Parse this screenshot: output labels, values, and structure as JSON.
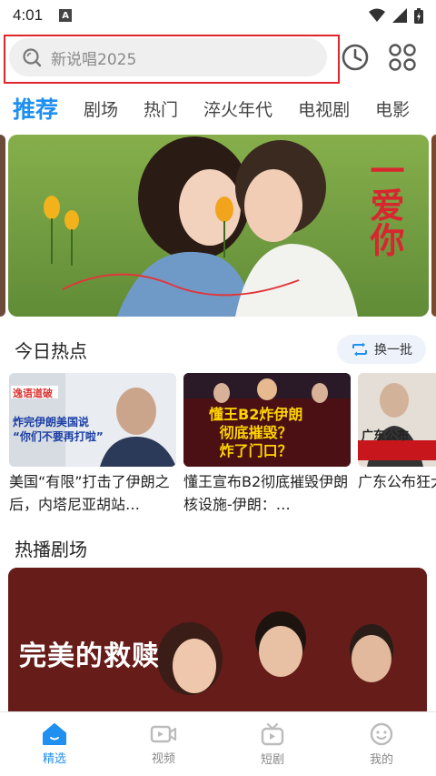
{
  "status_bar": {
    "time": "4:01",
    "notification_badge": "A"
  },
  "search": {
    "placeholder": "新说唱2025"
  },
  "tabs": [
    {
      "label": "推荐",
      "active": true
    },
    {
      "label": "剧场"
    },
    {
      "label": "热门"
    },
    {
      "label": "淬火年代"
    },
    {
      "label": "电视剧"
    },
    {
      "label": "电影"
    }
  ],
  "banner": {
    "title": "一爱你"
  },
  "hot_today": {
    "title": "今日热点",
    "refresh_label": "换一批",
    "items": [
      {
        "thumb_text": "炸完伊朗美国说\n“你们不要再打啦”",
        "caption": "美国“有限”打击了伊朗之后，内塔尼亚胡站…"
      },
      {
        "thumb_text": "懂王B2炸伊朗\n彻底摧毁？\n炸了门口？",
        "caption": "懂王宣布B2彻底摧毁伊朗核设施-伊朗：…"
      },
      {
        "thumb_text": "广东公布",
        "caption": "广东公布狂犬病可"
      }
    ]
  },
  "hot_theater": {
    "title": "热播剧场",
    "card_title": "完美的救赎"
  },
  "bottom_nav": [
    {
      "label": "精选",
      "icon": "home-icon",
      "active": true
    },
    {
      "label": "视频",
      "icon": "video-icon"
    },
    {
      "label": "短剧",
      "icon": "tv-icon"
    },
    {
      "label": "我的",
      "icon": "smile-icon"
    }
  ],
  "colors": {
    "accent": "#1f8ff0",
    "highlight_frame": "#e0262b"
  }
}
